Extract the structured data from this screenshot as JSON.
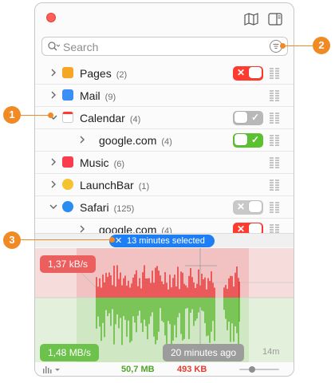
{
  "search": {
    "placeholder": "Search"
  },
  "apps": [
    {
      "id": "pages",
      "name": "Pages",
      "count": "(2)",
      "state": "off-red",
      "icon": "pages-icon",
      "expanded": false,
      "indent": 0
    },
    {
      "id": "mail",
      "name": "Mail",
      "count": "(9)",
      "state": "none",
      "icon": "mail-icon",
      "expanded": false,
      "indent": 0
    },
    {
      "id": "calendar",
      "name": "Calendar",
      "count": "(4)",
      "state": "on-gray",
      "icon": "calendar-icon",
      "expanded": true,
      "indent": 0
    },
    {
      "id": "calendar-google",
      "name": "google.com",
      "count": "(4)",
      "state": "on-green",
      "icon": "",
      "expanded": false,
      "indent": 1
    },
    {
      "id": "music",
      "name": "Music",
      "count": "(6)",
      "state": "none",
      "icon": "music-icon",
      "expanded": false,
      "indent": 0
    },
    {
      "id": "launchbar",
      "name": "LaunchBar",
      "count": "(1)",
      "state": "none",
      "icon": "launchbar-icon",
      "expanded": false,
      "indent": 0
    },
    {
      "id": "safari",
      "name": "Safari",
      "count": "(125)",
      "state": "off-gray",
      "icon": "safari-icon",
      "expanded": true,
      "indent": 0
    },
    {
      "id": "safari-google",
      "name": "google.com",
      "count": "(4)",
      "state": "off-red",
      "icon": "",
      "expanded": false,
      "indent": 1
    }
  ],
  "selection": {
    "label": "13 minutes selected"
  },
  "graph": {
    "upload_rate": "1,37 kB/s",
    "download_rate": "1,48 MB/s",
    "time_ago": "20 minutes ago",
    "axis_label": "14m"
  },
  "footer": {
    "downloaded": "50,7 MB",
    "uploaded": "493 KB"
  },
  "callouts": [
    "1",
    "2",
    "3"
  ],
  "colors": {
    "accent": "#1e7ef5",
    "deny": "#ff3b30",
    "allow": "#5ac130",
    "callout": "#f08a24",
    "upload_bg": "#f7d5d5",
    "download_bg": "#dff0d8"
  }
}
